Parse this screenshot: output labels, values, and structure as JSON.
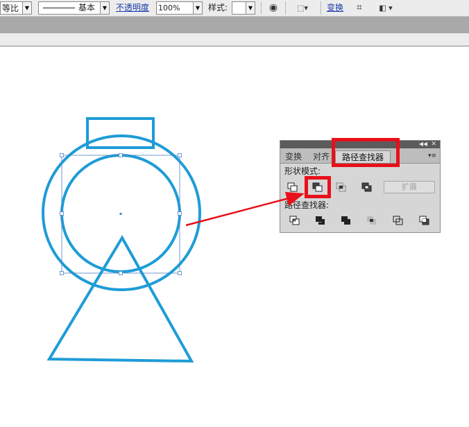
{
  "toolbar": {
    "profile_value": "等比",
    "stroke_label": "基本",
    "opacity_label": "不透明度",
    "opacity_value": "100%",
    "style_label": "样式:",
    "transform_label": "变换",
    "globe_icon": "globe-icon",
    "align_icon": "align-dropdown-icon",
    "isolate_icon": "isolate-icon",
    "arrange_icon": "arrange-icon"
  },
  "pathfinder_panel": {
    "tabs": [
      "变换",
      "对齐",
      "路径查找器"
    ],
    "active_tab": "路径查找器",
    "shape_modes_label": "形状模式:",
    "expand_button_label": "扩展",
    "pathfinders_label": "路径查找器:",
    "shape_mode_buttons": [
      "unite-icon",
      "minus-front-icon",
      "intersect-icon",
      "exclude-icon"
    ],
    "pathfinder_buttons": [
      "divide-icon",
      "trim-icon",
      "merge-icon",
      "crop-icon",
      "outline-icon",
      "minus-back-icon"
    ]
  },
  "colors": {
    "artwork_stroke": "#1e9cd7",
    "selection": "#4a7fc6",
    "highlight": "#e8101a",
    "panel_bg": "#d6d6d6"
  }
}
